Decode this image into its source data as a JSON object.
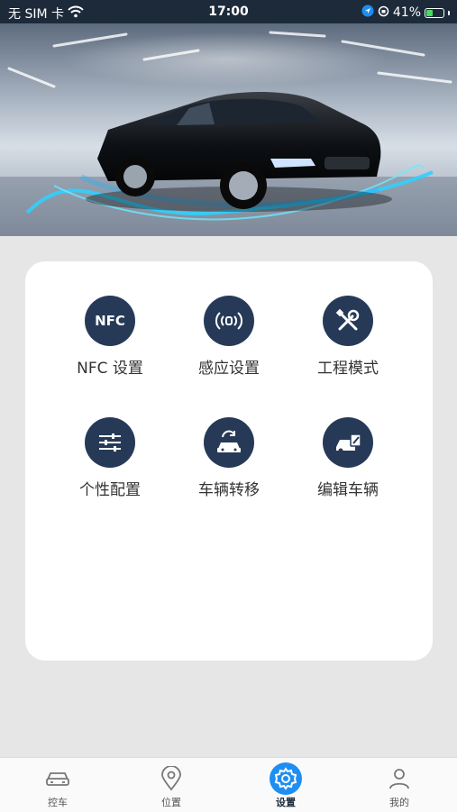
{
  "status_bar": {
    "carrier": "无 SIM 卡",
    "time": "17:00",
    "battery": "41%",
    "battery_level": 0.41
  },
  "banner": {
    "alt": "car-hero-image"
  },
  "functions": [
    {
      "label": "NFC 设置",
      "icon": "nfc-icon",
      "glyph": "NFC"
    },
    {
      "label": "感应设置",
      "icon": "sensing-icon"
    },
    {
      "label": "工程模式",
      "icon": "tools-icon"
    },
    {
      "label": "个性配置",
      "icon": "sliders-icon"
    },
    {
      "label": "车辆转移",
      "icon": "car-transfer-icon"
    },
    {
      "label": "编辑车辆",
      "icon": "edit-car-icon"
    }
  ],
  "tabbar": {
    "tabs": [
      {
        "label": "控车",
        "icon": "car-icon"
      },
      {
        "label": "位置",
        "icon": "location-pin-icon"
      },
      {
        "label": "设置",
        "icon": "gear-icon",
        "active": true
      },
      {
        "label": "我的",
        "icon": "person-icon"
      }
    ]
  },
  "colors": {
    "accent": "#1e8ef2",
    "icon_bg": "#263a58",
    "status_bar": "#1d2a3a",
    "page_bg": "#e6e6e6"
  }
}
